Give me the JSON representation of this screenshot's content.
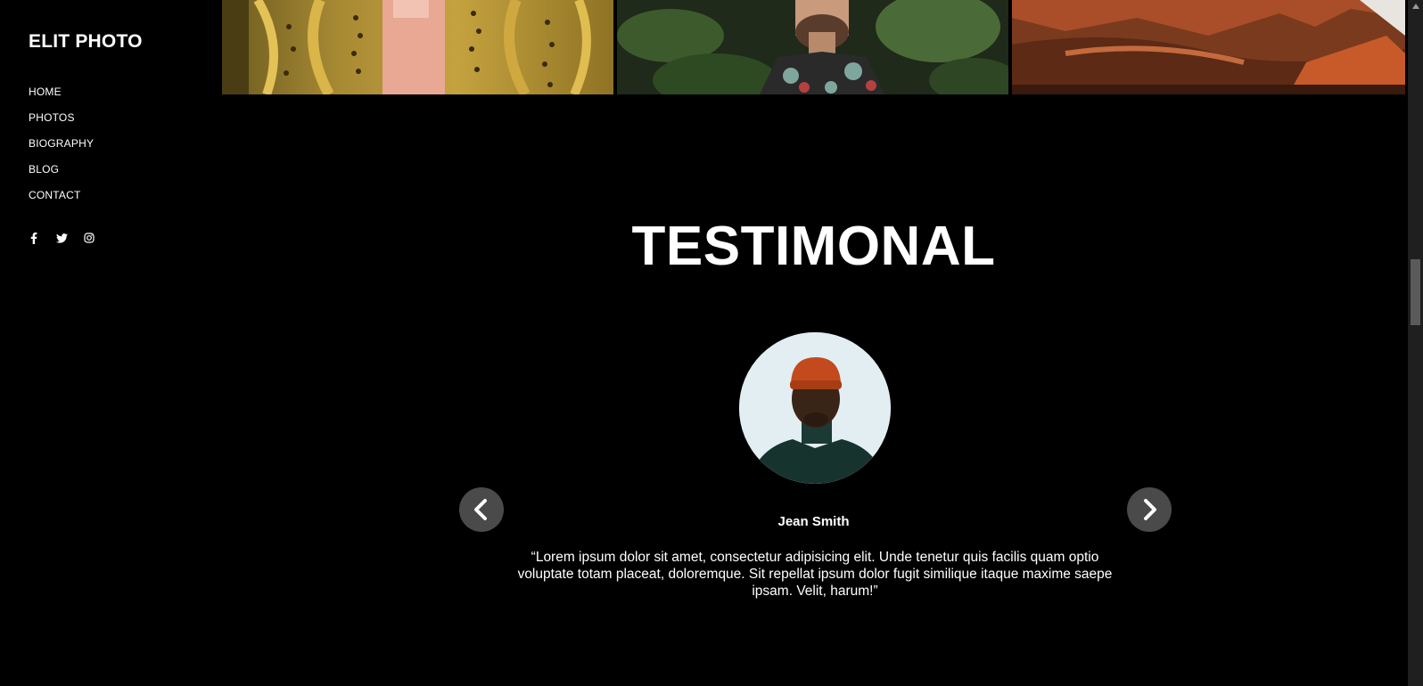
{
  "brand": {
    "name": "ELIT PHOTO"
  },
  "nav": {
    "items": [
      {
        "label": "HOME"
      },
      {
        "label": "PHOTOS"
      },
      {
        "label": "BIOGRAPHY"
      },
      {
        "label": "BLOG"
      },
      {
        "label": "CONTACT"
      }
    ]
  },
  "social": {
    "icons": [
      "facebook-icon",
      "twitter-icon",
      "instagram-icon"
    ]
  },
  "gallery": {
    "tiles": [
      "cactus-photo",
      "portrait-photo",
      "red-rock-canyon-photo"
    ]
  },
  "testimonial": {
    "title": "TESTIMONAL",
    "name": "Jean Smith",
    "quote": "“Lorem ipsum dolor sit amet, consectetur adipisicing elit. Unde tenetur quis facilis quam optio voluptate totam placeat, doloremque. Sit repellat ipsum dolor fugit similique itaque maxime saepe ipsam. Velit, harum!”",
    "prev_icon": "chevron-left-icon",
    "next_icon": "chevron-right-icon"
  },
  "colors": {
    "background": "#000000",
    "text": "#ffffff",
    "arrow_bg": "#4a4a4a"
  }
}
